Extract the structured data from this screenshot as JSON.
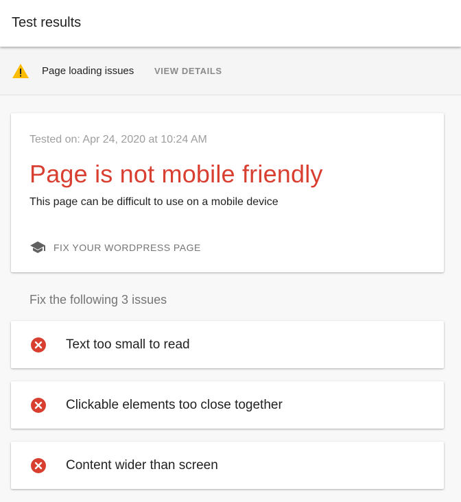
{
  "header": {
    "title": "Test results"
  },
  "warning_bar": {
    "icon": "warning-icon",
    "icon_color": "#fbbc04",
    "message": "Page loading issues",
    "action_label": "VIEW DETAILS"
  },
  "result_card": {
    "tested_on": "Tested on: Apr 24, 2020 at 10:24 AM",
    "headline": "Page is not mobile friendly",
    "headline_color": "#d93f31",
    "description": "This page can be difficult to use on a mobile device",
    "fix_link": {
      "icon": "graduation-cap-icon",
      "label": "FIX YOUR WORDPRESS PAGE"
    }
  },
  "issues": {
    "heading": "Fix the following 3 issues",
    "icon": "error-circle-icon",
    "icon_color": "#d93f31",
    "items": [
      {
        "label": "Text too small to read"
      },
      {
        "label": "Clickable elements too close together"
      },
      {
        "label": "Content wider than screen"
      }
    ]
  }
}
